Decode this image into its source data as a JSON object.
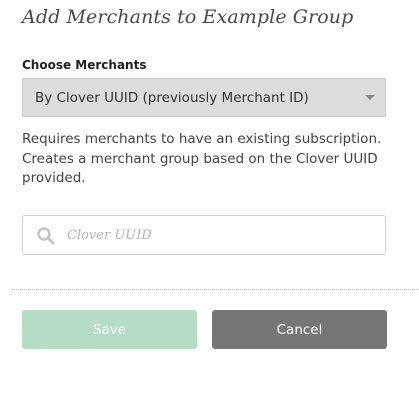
{
  "dialog": {
    "title": "Add Merchants to Example Group"
  },
  "choose_merchants": {
    "label": "Choose Merchants",
    "selected_option": "By Clover UUID (previously Merchant ID)",
    "help_lines": [
      "Requires merchants to have an existing subscription.",
      "Creates a merchant group based on the Clover UUID",
      "provided."
    ]
  },
  "search": {
    "icon": "search-icon",
    "placeholder": "Clover UUID",
    "value": ""
  },
  "actions": {
    "save_label": "Save",
    "cancel_label": "Cancel",
    "save_color": "#b5dcc4",
    "cancel_color": "#767676"
  }
}
